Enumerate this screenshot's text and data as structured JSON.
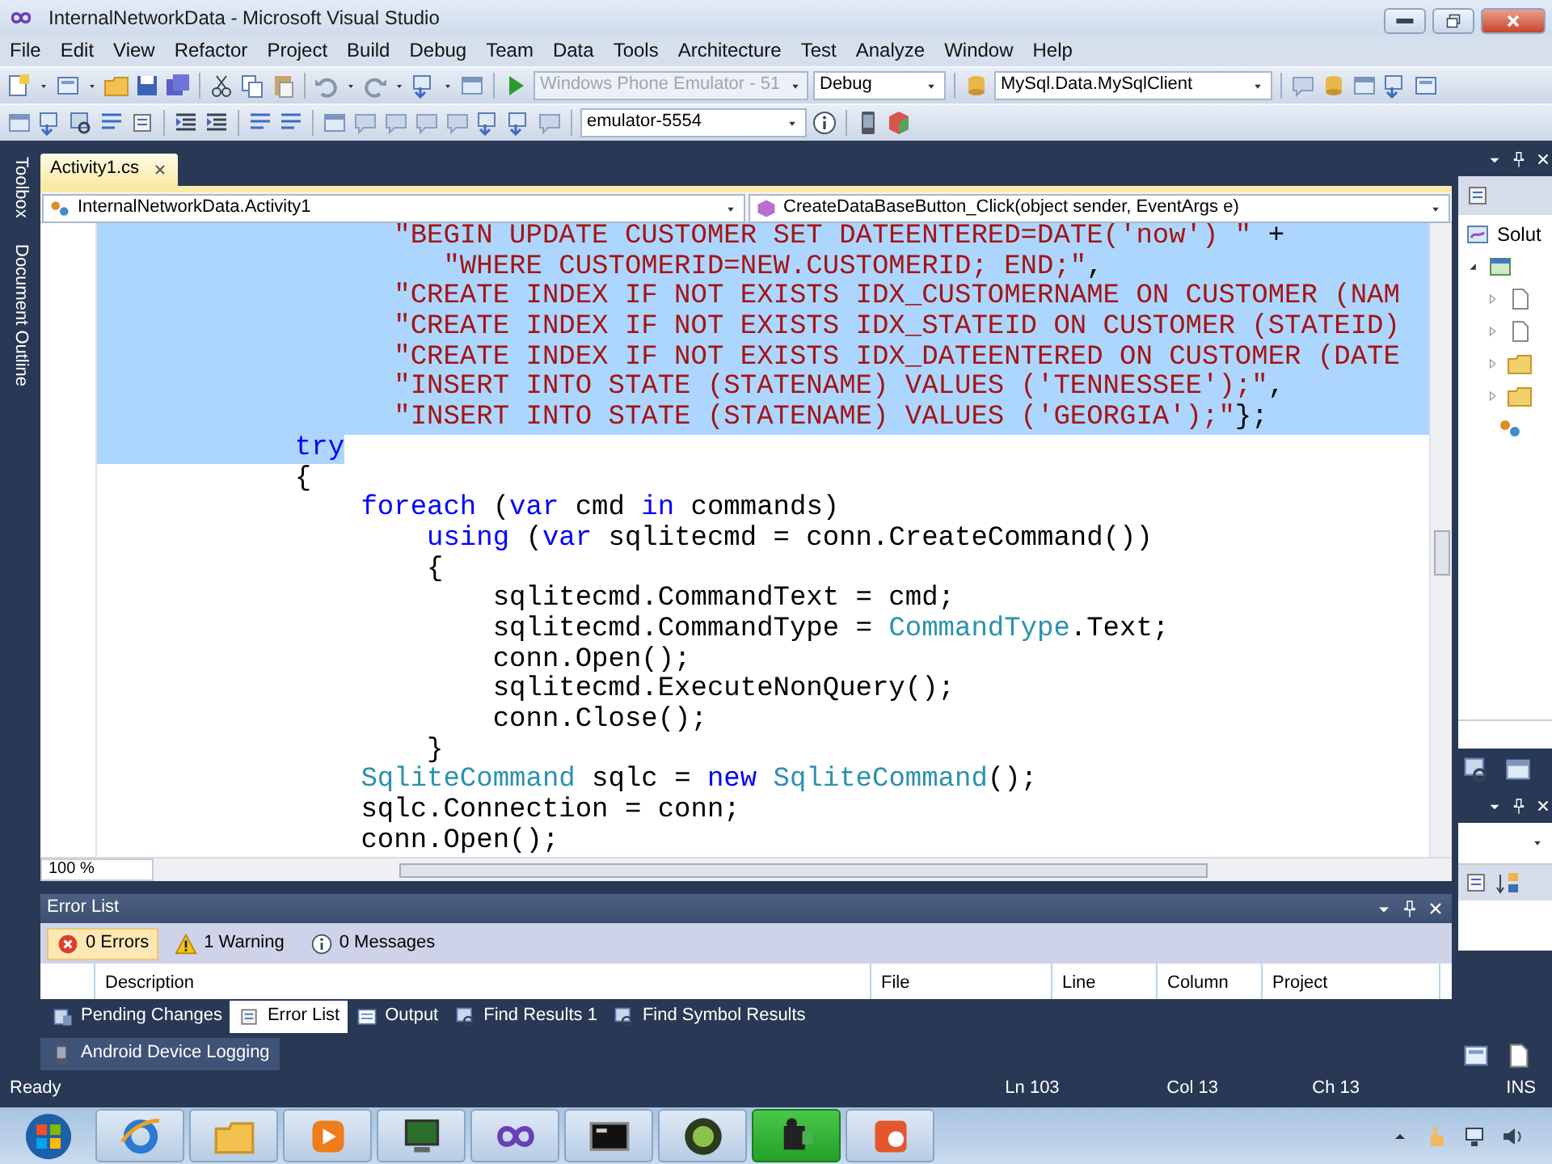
{
  "window": {
    "title": "InternalNetworkData - Microsoft Visual Studio"
  },
  "menu": [
    "File",
    "Edit",
    "View",
    "Refactor",
    "Project",
    "Build",
    "Debug",
    "Team",
    "Data",
    "Tools",
    "Architecture",
    "Test",
    "Analyze",
    "Window",
    "Help"
  ],
  "toolbar": {
    "platform_combo": {
      "value": "Windows Phone Emulator - 51",
      "disabled": true
    },
    "config_combo": {
      "value": "Debug",
      "disabled": false
    },
    "provider_combo": {
      "value": "MySql.Data.MySqlClient",
      "disabled": false
    },
    "device_combo": {
      "value": "emulator-5554",
      "disabled": false
    }
  },
  "side_tabs": [
    "Toolbox",
    "Document Outline"
  ],
  "editor": {
    "tabs": [
      {
        "label": "Activity1.cs",
        "selected": true
      }
    ],
    "type_dropdown": "InternalNetworkData.Activity1",
    "member_dropdown": "CreateDataBaseButton_Click(object sender, EventArgs e)",
    "zoom": "100 %",
    "lines": [
      {
        "selected": true,
        "partial": false,
        "tokens": [
          {
            "kind": "string",
            "text": "                  \"BEGIN UPDATE CUSTOMER SET DATEENTERED=DATE('now') \""
          },
          {
            "kind": "plain",
            "text": " +"
          }
        ]
      },
      {
        "selected": true,
        "partial": false,
        "tokens": [
          {
            "kind": "string",
            "text": "                     \"WHERE CUSTOMERID=NEW.CUSTOMERID; END;\""
          },
          {
            "kind": "plain",
            "text": ","
          }
        ]
      },
      {
        "selected": true,
        "partial": false,
        "tokens": [
          {
            "kind": "string",
            "text": "                  \"CREATE INDEX IF NOT EXISTS IDX_CUSTOMERNAME ON CUSTOMER (NAM"
          }
        ]
      },
      {
        "selected": true,
        "partial": false,
        "tokens": [
          {
            "kind": "string",
            "text": "                  \"CREATE INDEX IF NOT EXISTS IDX_STATEID ON CUSTOMER (STATEID)"
          }
        ]
      },
      {
        "selected": true,
        "partial": false,
        "tokens": [
          {
            "kind": "string",
            "text": "                  \"CREATE INDEX IF NOT EXISTS IDX_DATEENTERED ON CUSTOMER (DATE"
          }
        ]
      },
      {
        "selected": true,
        "partial": false,
        "tokens": [
          {
            "kind": "string",
            "text": "                  \"INSERT INTO STATE (STATENAME) VALUES ('TENNESSEE');\""
          },
          {
            "kind": "plain",
            "text": ","
          }
        ]
      },
      {
        "selected": true,
        "partial": false,
        "tokens": [
          {
            "kind": "string",
            "text": "                  \"INSERT INTO STATE (STATENAME) VALUES ('GEORGIA');\""
          },
          {
            "kind": "plain",
            "text": "};"
          }
        ]
      },
      {
        "selected": true,
        "partial": true,
        "tokens": [
          {
            "kind": "keyword",
            "text": "            try"
          }
        ]
      },
      {
        "selected": false,
        "tokens": [
          {
            "kind": "plain",
            "text": "            {"
          }
        ]
      },
      {
        "selected": false,
        "tokens": [
          {
            "kind": "keyword",
            "text": "                foreach"
          },
          {
            "kind": "plain",
            "text": " ("
          },
          {
            "kind": "keyword",
            "text": "var"
          },
          {
            "kind": "plain",
            "text": " cmd "
          },
          {
            "kind": "keyword",
            "text": "in"
          },
          {
            "kind": "plain",
            "text": " commands)"
          }
        ]
      },
      {
        "selected": false,
        "tokens": [
          {
            "kind": "keyword",
            "text": "                    using"
          },
          {
            "kind": "plain",
            "text": " ("
          },
          {
            "kind": "keyword",
            "text": "var"
          },
          {
            "kind": "plain",
            "text": " sqlitecmd = conn.CreateCommand())"
          }
        ]
      },
      {
        "selected": false,
        "tokens": [
          {
            "kind": "plain",
            "text": "                    {"
          }
        ]
      },
      {
        "selected": false,
        "tokens": [
          {
            "kind": "plain",
            "text": "                        sqlitecmd.CommandText = cmd;"
          }
        ]
      },
      {
        "selected": false,
        "tokens": [
          {
            "kind": "plain",
            "text": "                        sqlitecmd.CommandType = "
          },
          {
            "kind": "type",
            "text": "CommandType"
          },
          {
            "kind": "plain",
            "text": ".Text;"
          }
        ]
      },
      {
        "selected": false,
        "tokens": [
          {
            "kind": "plain",
            "text": "                        conn.Open();"
          }
        ]
      },
      {
        "selected": false,
        "tokens": [
          {
            "kind": "plain",
            "text": "                        sqlitecmd.ExecuteNonQuery();"
          }
        ]
      },
      {
        "selected": false,
        "tokens": [
          {
            "kind": "plain",
            "text": "                        conn.Close();"
          }
        ]
      },
      {
        "selected": false,
        "tokens": [
          {
            "kind": "plain",
            "text": "                    }"
          }
        ]
      },
      {
        "selected": false,
        "tokens": [
          {
            "kind": "type",
            "text": "                SqliteCommand"
          },
          {
            "kind": "plain",
            "text": " sqlc = "
          },
          {
            "kind": "keyword",
            "text": "new"
          },
          {
            "kind": "type",
            "text": " SqliteCommand"
          },
          {
            "kind": "plain",
            "text": "();"
          }
        ]
      },
      {
        "selected": false,
        "tokens": [
          {
            "kind": "plain",
            "text": "                sqlc.Connection = conn;"
          }
        ]
      },
      {
        "selected": false,
        "tokens": [
          {
            "kind": "plain",
            "text": "                conn.Open();"
          }
        ]
      }
    ]
  },
  "solution_explorer": {
    "label": "Solut"
  },
  "error_list": {
    "title": "Error List",
    "filters": [
      {
        "kind": "error",
        "label": "0 Errors",
        "selected": true
      },
      {
        "kind": "warning",
        "label": "1 Warning",
        "selected": false
      },
      {
        "kind": "message",
        "label": "0 Messages",
        "selected": false
      }
    ],
    "columns": [
      "Description",
      "File",
      "Line",
      "Column",
      "Project"
    ]
  },
  "tool_tabs": [
    {
      "label": "Pending Changes",
      "selected": false
    },
    {
      "label": "Error List",
      "selected": true
    },
    {
      "label": "Output",
      "selected": false
    },
    {
      "label": "Find Results 1",
      "selected": false
    },
    {
      "label": "Find Symbol Results",
      "selected": false
    }
  ],
  "extra_tabs": [
    "Android Device Logging"
  ],
  "status_bar": {
    "state": "Ready",
    "line": "Ln 103",
    "col": "Col 13",
    "ch": "Ch 13",
    "mode": "INS"
  },
  "taskbar": {
    "apps": [
      {
        "kind": "browser",
        "selected": false
      },
      {
        "kind": "folder",
        "selected": false
      },
      {
        "kind": "media",
        "selected": false
      },
      {
        "kind": "monitor",
        "selected": false
      },
      {
        "kind": "infinity",
        "selected": false
      },
      {
        "kind": "terminal",
        "selected": false
      },
      {
        "kind": "disc",
        "selected": false
      },
      {
        "kind": "camera",
        "selected": true
      },
      {
        "kind": "slides",
        "selected": false
      }
    ]
  }
}
